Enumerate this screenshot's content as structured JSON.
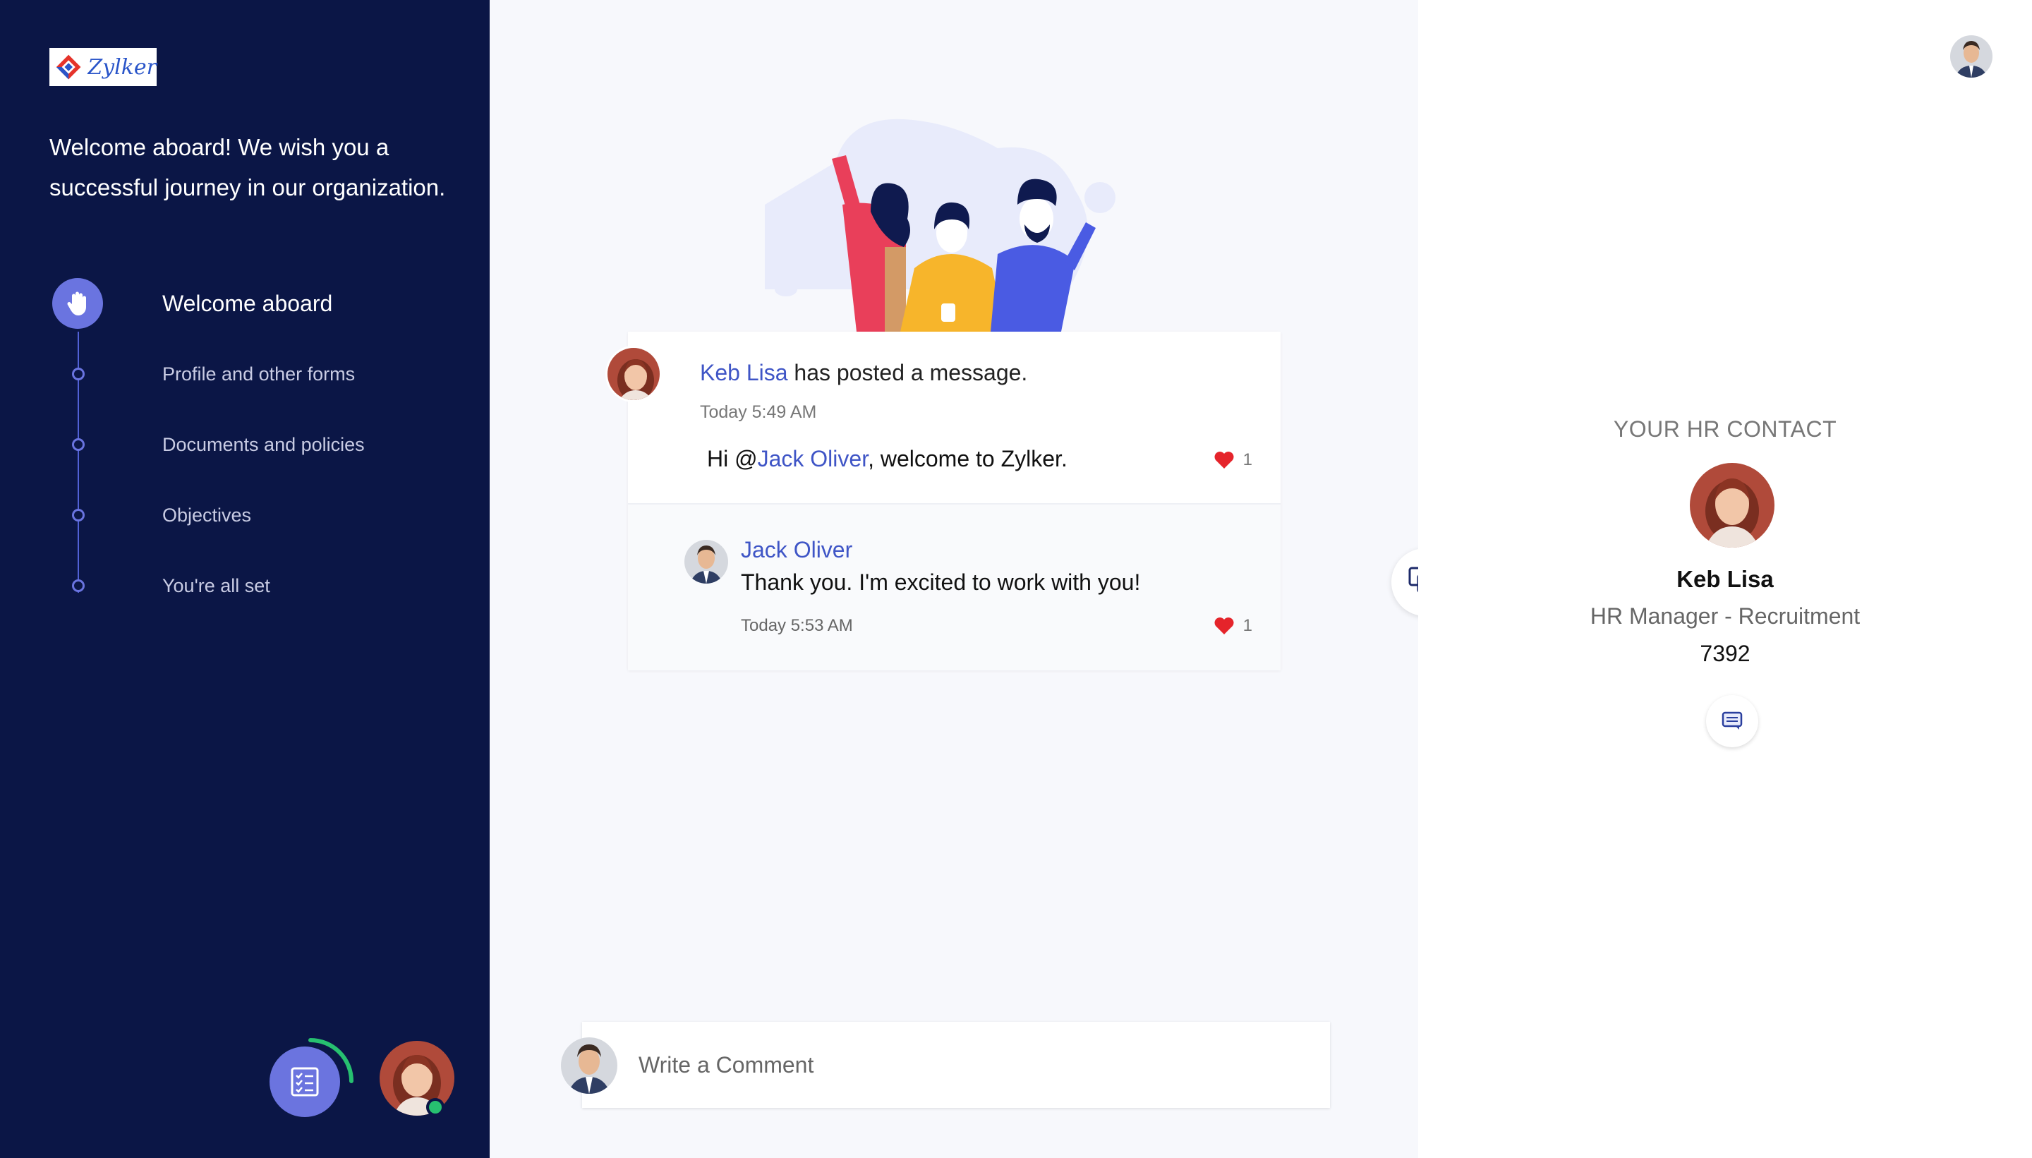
{
  "brand": {
    "logo_text": "Zylker"
  },
  "sidebar": {
    "welcome_message": "Welcome aboard! We wish you a successful journey in our organization.",
    "steps": [
      {
        "label": "Welcome aboard",
        "active": true,
        "icon": "hand-icon"
      },
      {
        "label": "Profile and other forms",
        "active": false
      },
      {
        "label": "Documents and policies",
        "active": false
      },
      {
        "label": "Objectives",
        "active": false
      },
      {
        "label": "You're all set",
        "active": false
      }
    ],
    "task_button_icon": "checklist-icon",
    "colors": {
      "background": "#0b1646",
      "accent": "#6a74e0",
      "online": "#27c070"
    }
  },
  "feed": {
    "post": {
      "author": "Keb Lisa",
      "action_text": "has posted a message.",
      "time": "Today 5:49 AM",
      "message_prefix": "Hi @",
      "mention": "Jack Oliver",
      "message_suffix": ", welcome to Zylker.",
      "likes": "1"
    },
    "reply": {
      "author": "Jack Oliver",
      "message": "Thank you. I'm excited to work with you!",
      "time": "Today 5:53 AM",
      "likes": "1"
    },
    "comment_placeholder": "Write a Comment"
  },
  "hr_contact": {
    "heading": "YOUR HR CONTACT",
    "name": "Keb Lisa",
    "role": "HR Manager - Recruitment",
    "extension": "7392"
  },
  "colors": {
    "link": "#3f55c6",
    "heart": "#e5242b"
  }
}
